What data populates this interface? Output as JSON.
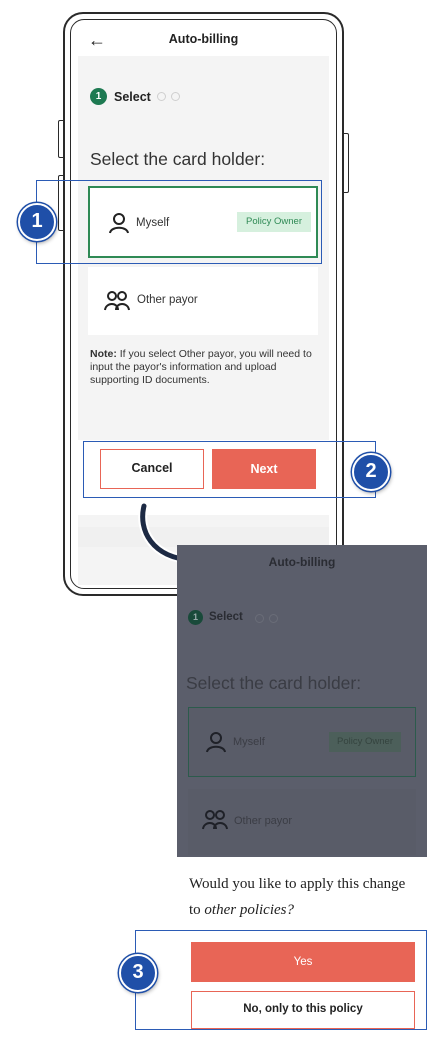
{
  "screen1": {
    "header": {
      "back_icon": "arrow-left-icon",
      "title": "Auto-billing"
    },
    "stepper": {
      "step_number": "1",
      "step_label": "Select"
    },
    "heading": "Select the card holder:",
    "options": [
      {
        "label": "Myself",
        "badge": "Policy Owner",
        "icon": "person-icon",
        "selected": true
      },
      {
        "label": "Other payor",
        "icon": "people-icon",
        "selected": false
      }
    ],
    "note": {
      "label": "Note:",
      "text": "If you select Other payor, you will need to input the payor's information and upload supporting ID documents."
    },
    "buttons": {
      "cancel": "Cancel",
      "next": "Next"
    }
  },
  "callouts": [
    "1",
    "2",
    "3"
  ],
  "screen2": {
    "header": {
      "title": "Auto-billing"
    },
    "stepper": {
      "step_number": "1",
      "step_label": "Select"
    },
    "heading": "Select the card holder:",
    "options": [
      {
        "label": "Myself",
        "badge": "Policy Owner",
        "icon": "person-icon"
      },
      {
        "label": "Other payor",
        "icon": "people-icon"
      }
    ],
    "dialog": {
      "question_start": "Would you like to apply this change",
      "question_to": "to ",
      "question_emphasis": "other policies?",
      "yes": "Yes",
      "no": "No, only to this policy"
    }
  },
  "colors": {
    "accent_coral": "#e86556",
    "selected_green": "#2f8a55",
    "callout_blue": "#1f4fa8",
    "overlay_gray": "#5b5e6b"
  }
}
